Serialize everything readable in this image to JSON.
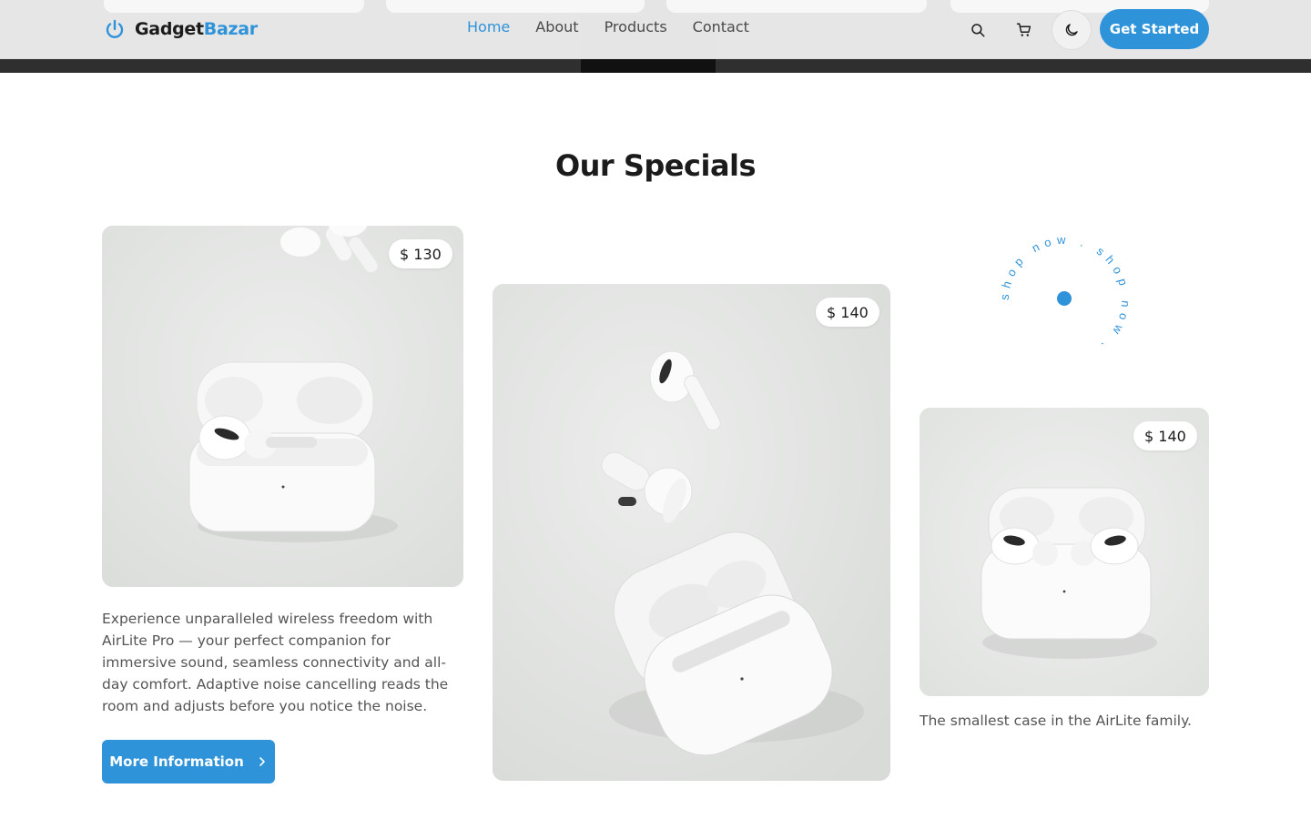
{
  "brand": {
    "name_part1": "Gadget",
    "name_part2": "Bazar",
    "icon": "power-icon"
  },
  "nav": [
    {
      "label": "Home",
      "active": true
    },
    {
      "label": "About",
      "active": false
    },
    {
      "label": "Products",
      "active": false
    },
    {
      "label": "Contact",
      "active": false
    }
  ],
  "header_icons": [
    "search-icon",
    "cart-icon",
    "moon-icon"
  ],
  "cta_label": "Get Started",
  "section_title": "Our Specials",
  "products": [
    {
      "price": "$ 130",
      "description": "Experience unparalleled wireless freedom with AirLite Pro — your perfect companion for immersive sound, seamless connectivity and all-day comfort. Adaptive noise cancelling reads the room and adjusts before you notice the noise.",
      "button_label": "More Information"
    },
    {
      "price": "$ 140"
    },
    {
      "price": "$ 140",
      "description": "The smallest case in the AirLite family."
    }
  ],
  "circular_text": "shop now . shop now .",
  "colors": {
    "accent": "#2f93d9",
    "text": "#1b1b1b",
    "muted": "#555555",
    "header_bg": "#ececed"
  }
}
